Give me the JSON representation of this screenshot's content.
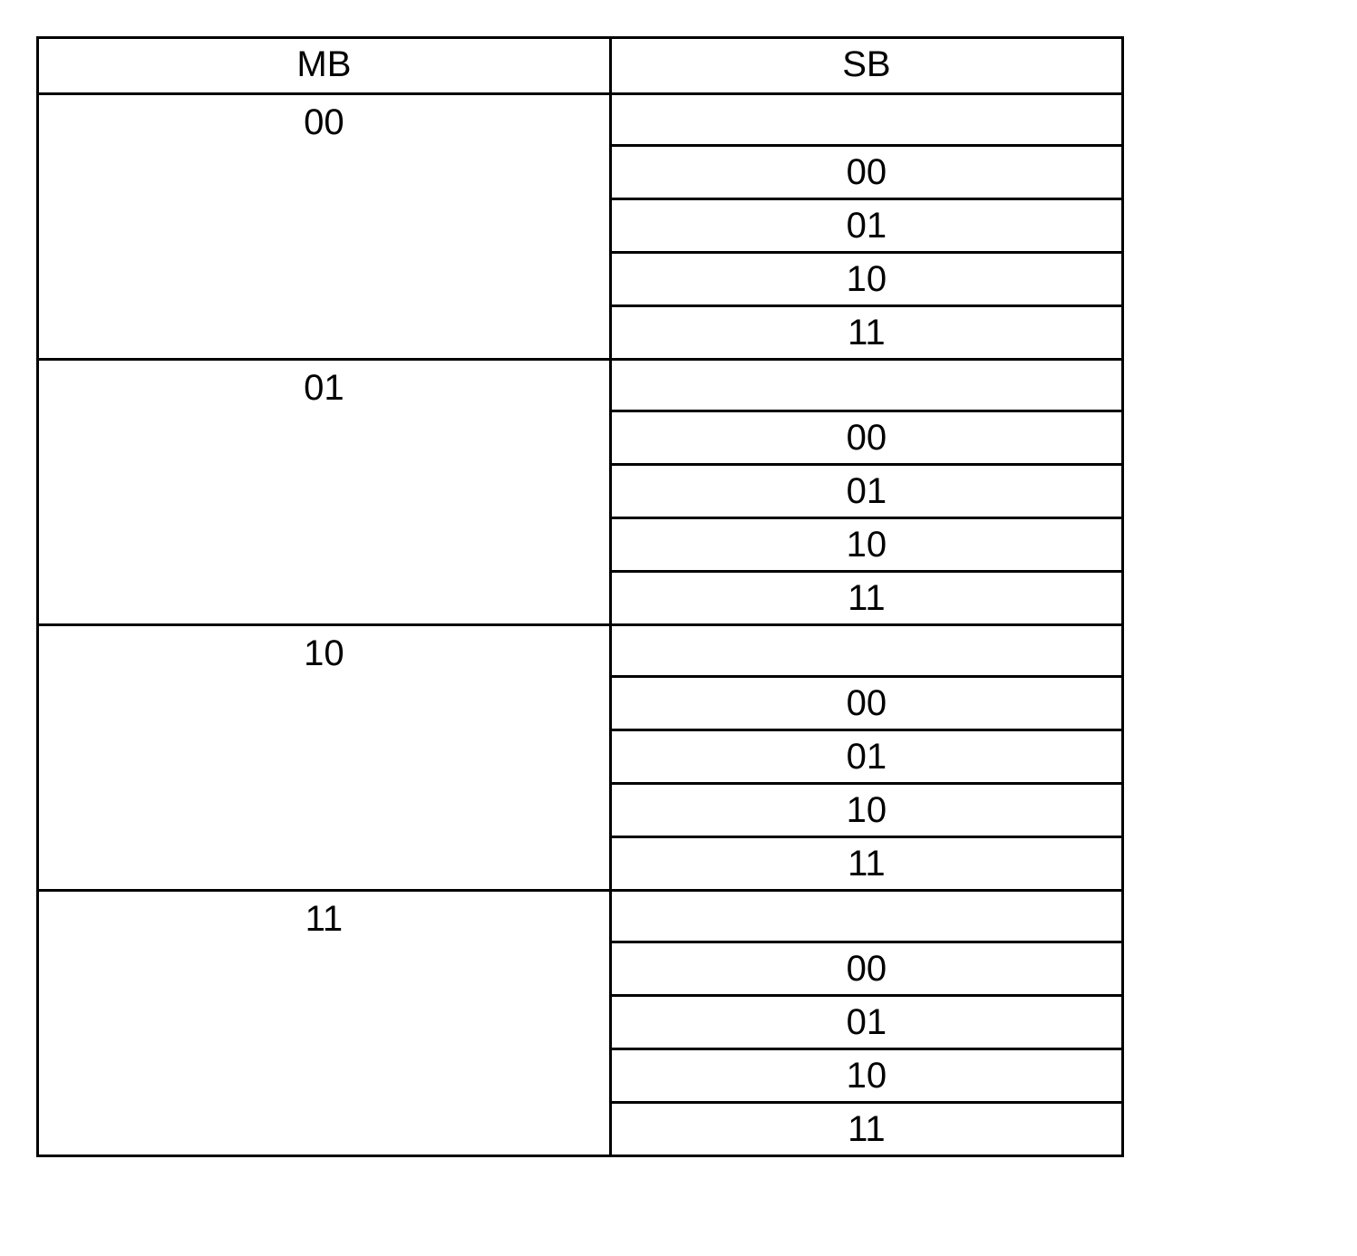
{
  "headers": {
    "mb": "MB",
    "sb": "SB"
  },
  "groups": [
    {
      "mb": "00",
      "sb": [
        "",
        "00",
        "01",
        "10",
        "11"
      ]
    },
    {
      "mb": "01",
      "sb": [
        "",
        "00",
        "01",
        "10",
        "11"
      ]
    },
    {
      "mb": "10",
      "sb": [
        "",
        "00",
        "01",
        "10",
        "11"
      ]
    },
    {
      "mb": "11",
      "sb": [
        "",
        "00",
        "01",
        "10",
        "11"
      ]
    }
  ]
}
